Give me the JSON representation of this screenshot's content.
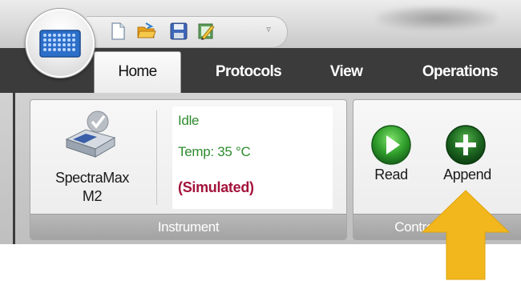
{
  "quick_access_toolbar": {
    "icons": [
      "new-document-icon",
      "open-folder-icon",
      "save-icon",
      "edit-protocol-icon"
    ],
    "dropdown_glyph": "▿"
  },
  "tabs": [
    {
      "label": "Home",
      "selected": true
    },
    {
      "label": "Protocols",
      "selected": false
    },
    {
      "label": "View",
      "selected": false
    },
    {
      "label": "Operations",
      "selected": false
    }
  ],
  "instrument_group": {
    "name_line1": "SpectraMax",
    "name_line2": "M2",
    "status": "Idle",
    "temperature": "Temp: 35 °C",
    "mode": "(Simulated)",
    "label": "Instrument"
  },
  "control_group": {
    "read_label": "Read",
    "append_label": "Append",
    "label": "Control & Status"
  },
  "colors": {
    "status_green": "#2e8b2e",
    "simulated_red": "#a3133a",
    "tab_bar": "#3b3b3b",
    "highlight_arrow": "#f2b71c"
  }
}
